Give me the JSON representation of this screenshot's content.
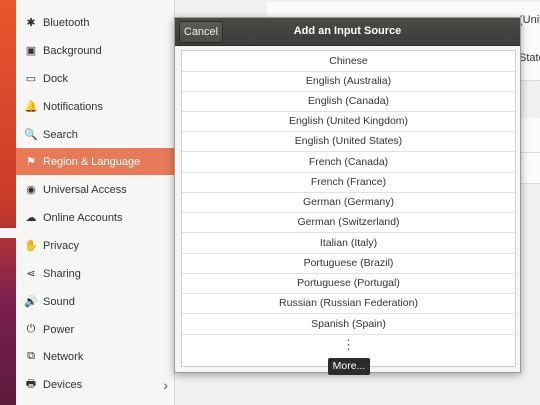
{
  "sidebar": {
    "items": [
      {
        "label": "Bluetooth",
        "icon": "bluetooth-icon",
        "glyph": "✱"
      },
      {
        "label": "Background",
        "icon": "background-icon",
        "glyph": "▣"
      },
      {
        "label": "Dock",
        "icon": "dock-icon",
        "glyph": "▭"
      },
      {
        "label": "Notifications",
        "icon": "bell-icon",
        "glyph": "🔔"
      },
      {
        "label": "Search",
        "icon": "search-icon",
        "glyph": "🔍"
      },
      {
        "label": "Region & Language",
        "icon": "flag-icon",
        "glyph": "⚑"
      },
      {
        "label": "Universal Access",
        "icon": "accessibility-icon",
        "glyph": "◉"
      },
      {
        "label": "Online Accounts",
        "icon": "online-accounts-icon",
        "glyph": "☁"
      },
      {
        "label": "Privacy",
        "icon": "privacy-hand-icon",
        "glyph": "✋"
      },
      {
        "label": "Sharing",
        "icon": "share-icon",
        "glyph": "⋖"
      },
      {
        "label": "Sound",
        "icon": "speaker-icon",
        "glyph": "🔊"
      },
      {
        "label": "Power",
        "icon": "power-icon",
        "glyph": "⏻"
      },
      {
        "label": "Network",
        "icon": "network-icon",
        "glyph": "⧉"
      },
      {
        "label": "Devices",
        "icon": "devices-icon",
        "glyph": "🖶"
      }
    ],
    "active": "Region & Language"
  },
  "background_pane": {
    "row1_text": "(Unit",
    "row2_text": "State"
  },
  "dialog": {
    "title": "Add an Input Source",
    "cancel_label": "Cancel",
    "items": [
      "Chinese",
      "English (Australia)",
      "English (Canada)",
      "English (United Kingdom)",
      "English (United States)",
      "French (Canada)",
      "French (France)",
      "German (Germany)",
      "German (Switzerland)",
      "Italian (Italy)",
      "Portuguese (Brazil)",
      "Portuguese (Portugal)",
      "Russian (Russian Federation)",
      "Spanish (Spain)"
    ],
    "more_dots": "⋮",
    "more_tooltip": "More..."
  },
  "colors": {
    "accent": "#e77a58",
    "header_bg": "#3c3c3a"
  }
}
